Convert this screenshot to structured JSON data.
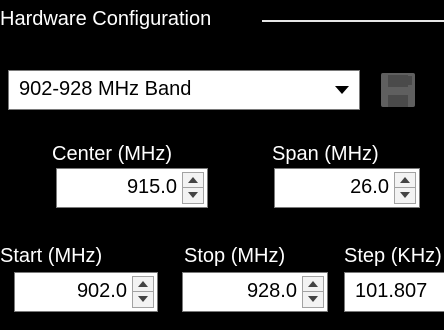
{
  "group": {
    "title": "Hardware Configuration"
  },
  "band": {
    "selected": "902-928 MHz Band"
  },
  "save": {
    "icon": "floppy-disk-icon"
  },
  "fields": {
    "center": {
      "label": "Center (MHz)",
      "value": "915.0"
    },
    "span": {
      "label": "Span (MHz)",
      "value": "26.0"
    },
    "start": {
      "label": "Start (MHz)",
      "value": "902.0"
    },
    "stop": {
      "label": "Stop (MHz)",
      "value": "928.0"
    },
    "step": {
      "label": "Step (KHz)",
      "value": "101.807"
    }
  },
  "colors": {
    "background": "#000000",
    "text": "#ffffff",
    "field": "#ffffff",
    "save_icon": "#5f5f5f"
  }
}
